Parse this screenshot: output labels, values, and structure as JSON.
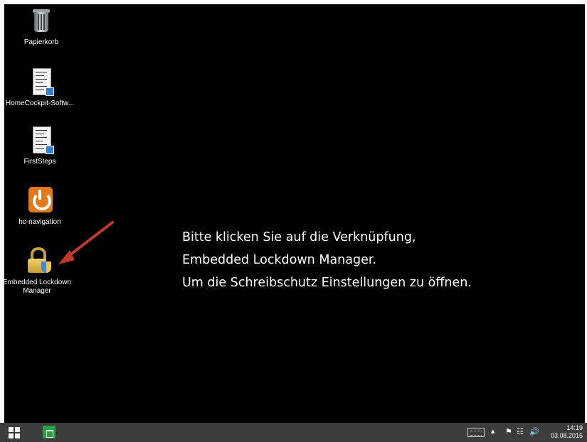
{
  "desktop": {
    "icons": [
      {
        "label": "Papierkorb",
        "icon": "recycle-bin-icon"
      },
      {
        "label": "HomeCockpit-Softw...",
        "icon": "document-shortcut-icon"
      },
      {
        "label": "FirstSteps",
        "icon": "document-shortcut-icon"
      },
      {
        "label": "hc-navigation",
        "icon": "power-icon"
      },
      {
        "label": "Embedded Lockdown Manager",
        "icon": "lock-shield-icon"
      }
    ],
    "instructions": [
      "Bitte klicken Sie auf die Verknüpfung,",
      "Embedded Lockdown Manager.",
      "Um die Schreibschutz Einstellungen zu öffnen."
    ]
  },
  "annotation": {
    "arrow_color": "#c0392b"
  },
  "taskbar": {
    "buttons": [
      "windows-start-icon",
      "store-icon"
    ],
    "tray": [
      "keyboard-icon",
      "chevron-up-icon",
      "flag-icon",
      "network-icon",
      "speaker-icon"
    ],
    "time": "14:19",
    "date": "03.08.2015"
  }
}
